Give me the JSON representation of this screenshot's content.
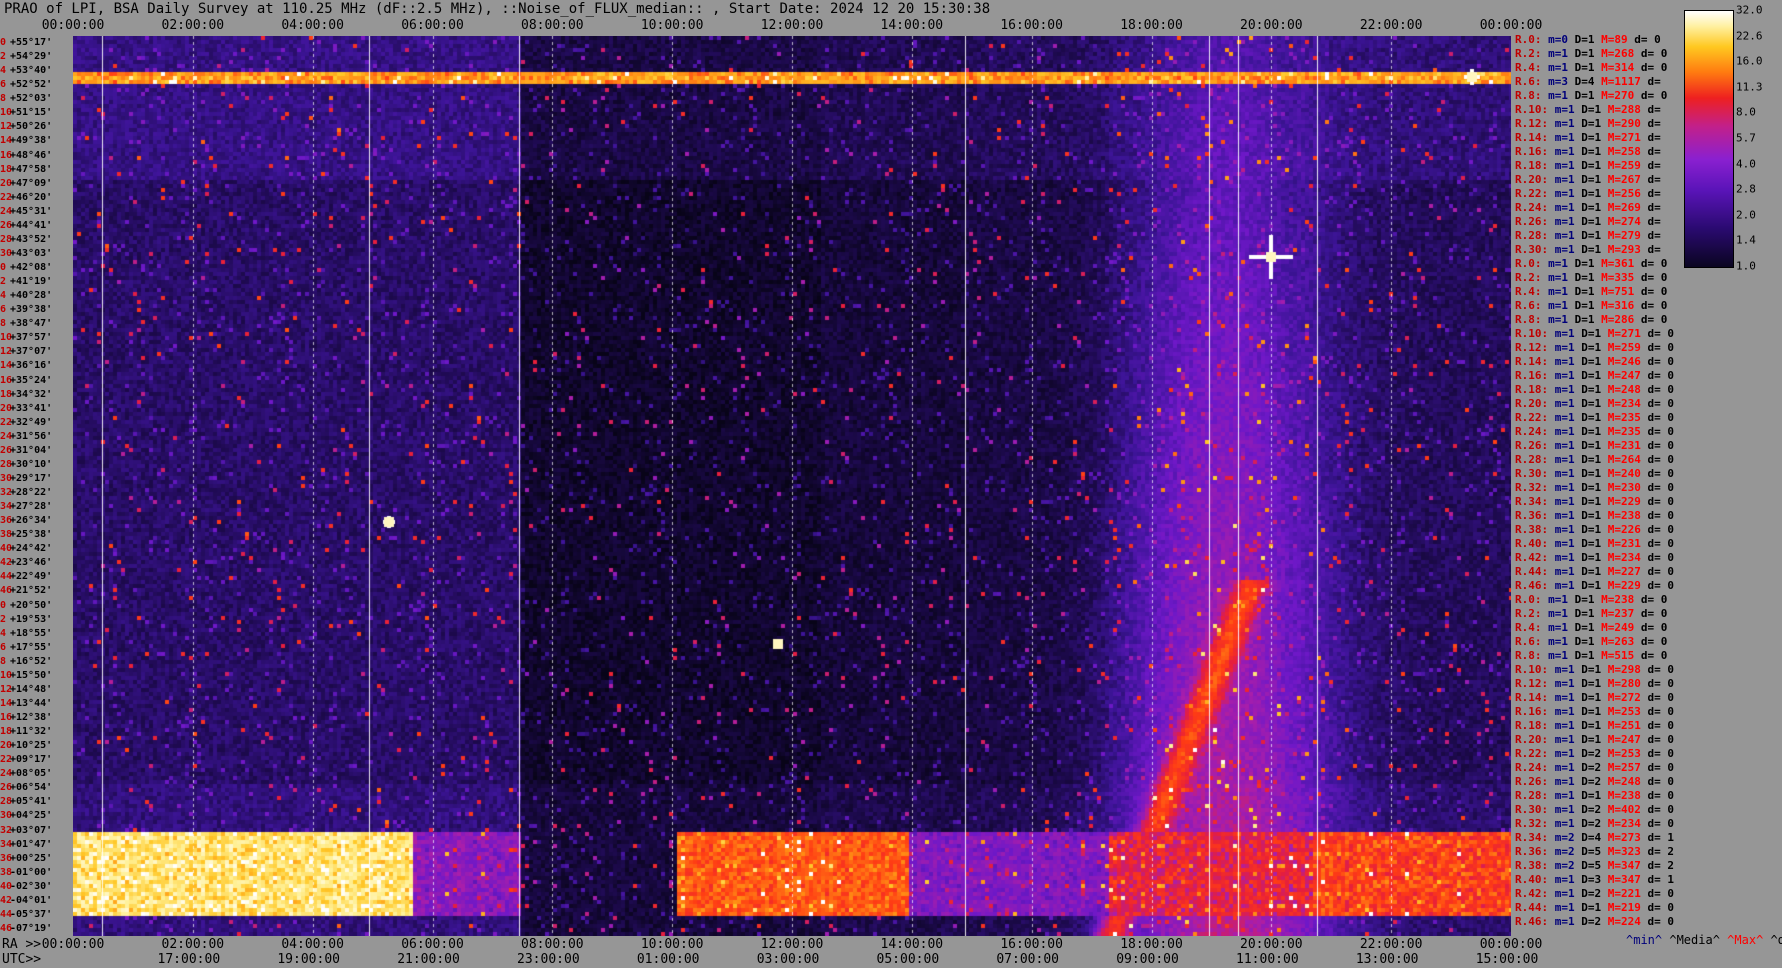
{
  "title": "PRAO of LPI, BSA Daily Survey at 110.25 MHz (dF::2.5 MHz), ::Noise_of_FLUX_median:: , Start Date: 2024 12 20 15:30:38",
  "top_axis_labels": [
    "00:00:00",
    "02:00:00",
    "04:00:00",
    "06:00:00",
    "08:00:00",
    "10:00:00",
    "12:00:00",
    "14:00:00",
    "16:00:00",
    "18:00:00",
    "20:00:00",
    "22:00:00",
    "00:00:00"
  ],
  "ra_prefix": "RA >>",
  "bottom_ra_labels": [
    "00:00:00",
    "02:00:00",
    "04:00:00",
    "06:00:00",
    "08:00:00",
    "10:00:00",
    "12:00:00",
    "14:00:00",
    "16:00:00",
    "18:00:00",
    "20:00:00",
    "22:00:00",
    "00:00:00"
  ],
  "utc_prefix": "UTC>>",
  "utc_labels": [
    "17:00:00",
    "19:00:00",
    "21:00:00",
    "23:00:00",
    "01:00:00",
    "03:00:00",
    "05:00:00",
    "07:00:00",
    "09:00:00",
    "11:00:00",
    "13:00:00",
    "15:00:00"
  ],
  "declination_rows": [
    {
      "idx": "0",
      "dec": "+55°17'"
    },
    {
      "idx": "2",
      "dec": "+54°29'"
    },
    {
      "idx": "4",
      "dec": "+53°40'"
    },
    {
      "idx": "6",
      "dec": "+52°52'"
    },
    {
      "idx": "8",
      "dec": "+52°03'"
    },
    {
      "idx": "10",
      "dec": "+51°15'"
    },
    {
      "idx": "12",
      "dec": "+50°26'"
    },
    {
      "idx": "14",
      "dec": "+49°38'"
    },
    {
      "idx": "16",
      "dec": "+48°46'"
    },
    {
      "idx": "18",
      "dec": "+47°58'"
    },
    {
      "idx": "20",
      "dec": "+47°09'"
    },
    {
      "idx": "22",
      "dec": "+46°20'"
    },
    {
      "idx": "24",
      "dec": "+45°31'"
    },
    {
      "idx": "26",
      "dec": "+44°41'"
    },
    {
      "idx": "28",
      "dec": "+43°52'"
    },
    {
      "idx": "30",
      "dec": "+43°03'"
    },
    {
      "idx": "0",
      "dec": "+42°08'"
    },
    {
      "idx": "2",
      "dec": "+41°19'"
    },
    {
      "idx": "4",
      "dec": "+40°28'"
    },
    {
      "idx": "6",
      "dec": "+39°38'"
    },
    {
      "idx": "8",
      "dec": "+38°47'"
    },
    {
      "idx": "10",
      "dec": "+37°57'"
    },
    {
      "idx": "12",
      "dec": "+37°07'"
    },
    {
      "idx": "14",
      "dec": "+36°16'"
    },
    {
      "idx": "16",
      "dec": "+35°24'"
    },
    {
      "idx": "18",
      "dec": "+34°32'"
    },
    {
      "idx": "20",
      "dec": "+33°41'"
    },
    {
      "idx": "22",
      "dec": "+32°49'"
    },
    {
      "idx": "24",
      "dec": "+31°56'"
    },
    {
      "idx": "26",
      "dec": "+31°04'"
    },
    {
      "idx": "28",
      "dec": "+30°10'"
    },
    {
      "idx": "30",
      "dec": "+29°17'"
    },
    {
      "idx": "32",
      "dec": "+28°22'"
    },
    {
      "idx": "34",
      "dec": "+27°28'"
    },
    {
      "idx": "36",
      "dec": "+26°34'"
    },
    {
      "idx": "38",
      "dec": "+25°38'"
    },
    {
      "idx": "40",
      "dec": "+24°42'"
    },
    {
      "idx": "42",
      "dec": "+23°46'"
    },
    {
      "idx": "44",
      "dec": "+22°49'"
    },
    {
      "idx": "46",
      "dec": "+21°52'"
    },
    {
      "idx": "0",
      "dec": "+20°50'"
    },
    {
      "idx": "2",
      "dec": "+19°53'"
    },
    {
      "idx": "4",
      "dec": "+18°55'"
    },
    {
      "idx": "6",
      "dec": "+17°55'"
    },
    {
      "idx": "8",
      "dec": "+16°52'"
    },
    {
      "idx": "10",
      "dec": "+15°50'"
    },
    {
      "idx": "12",
      "dec": "+14°48'"
    },
    {
      "idx": "14",
      "dec": "+13°44'"
    },
    {
      "idx": "16",
      "dec": "+12°38'"
    },
    {
      "idx": "18",
      "dec": "+11°32'"
    },
    {
      "idx": "20",
      "dec": "+10°25'"
    },
    {
      "idx": "22",
      "dec": "+09°17'"
    },
    {
      "idx": "24",
      "dec": "+08°05'"
    },
    {
      "idx": "26",
      "dec": "+06°54'"
    },
    {
      "idx": "28",
      "dec": "+05°41'"
    },
    {
      "idx": "30",
      "dec": "+04°25'"
    },
    {
      "idx": "32",
      "dec": "+03°07'"
    },
    {
      "idx": "34",
      "dec": "+01°47'"
    },
    {
      "idx": "36",
      "dec": "+00°25'"
    },
    {
      "idx": "38",
      "dec": "-01°00'"
    },
    {
      "idx": "40",
      "dec": "-02°30'"
    },
    {
      "idx": "42",
      "dec": "-04°01'"
    },
    {
      "idx": "44",
      "dec": "-05°37'"
    },
    {
      "idx": "46",
      "dec": "-07°19'"
    }
  ],
  "row_stats": [
    {
      "r": "R.0:",
      "m": "m=0",
      "d": "D=1",
      "max": "M=89",
      "dev": "d= 0"
    },
    {
      "r": "R.2:",
      "m": "m=1",
      "d": "D=1",
      "max": "M=268",
      "dev": "d= 0"
    },
    {
      "r": "R.4:",
      "m": "m=1",
      "d": "D=1",
      "max": "M=314",
      "dev": "d= 0"
    },
    {
      "r": "R.6:",
      "m": "m=3",
      "d": "D=4",
      "max": "M=1117",
      "dev": "d="
    },
    {
      "r": "R.8:",
      "m": "m=1",
      "d": "D=1",
      "max": "M=270",
      "dev": "d= 0"
    },
    {
      "r": "R.10:",
      "m": "m=1",
      "d": "D=1",
      "max": "M=288",
      "dev": "d="
    },
    {
      "r": "R.12:",
      "m": "m=1",
      "d": "D=1",
      "max": "M=290",
      "dev": "d="
    },
    {
      "r": "R.14:",
      "m": "m=1",
      "d": "D=1",
      "max": "M=271",
      "dev": "d="
    },
    {
      "r": "R.16:",
      "m": "m=1",
      "d": "D=1",
      "max": "M=258",
      "dev": "d="
    },
    {
      "r": "R.18:",
      "m": "m=1",
      "d": "D=1",
      "max": "M=259",
      "dev": "d="
    },
    {
      "r": "R.20:",
      "m": "m=1",
      "d": "D=1",
      "max": "M=267",
      "dev": "d="
    },
    {
      "r": "R.22:",
      "m": "m=1",
      "d": "D=1",
      "max": "M=256",
      "dev": "d="
    },
    {
      "r": "R.24:",
      "m": "m=1",
      "d": "D=1",
      "max": "M=269",
      "dev": "d="
    },
    {
      "r": "R.26:",
      "m": "m=1",
      "d": "D=1",
      "max": "M=274",
      "dev": "d="
    },
    {
      "r": "R.28:",
      "m": "m=1",
      "d": "D=1",
      "max": "M=279",
      "dev": "d="
    },
    {
      "r": "R.30:",
      "m": "m=1",
      "d": "D=1",
      "max": "M=293",
      "dev": "d="
    },
    {
      "r": "R.0:",
      "m": "m=1",
      "d": "D=1",
      "max": "M=361",
      "dev": "d= 0"
    },
    {
      "r": "R.2:",
      "m": "m=1",
      "d": "D=1",
      "max": "M=335",
      "dev": "d= 0"
    },
    {
      "r": "R.4:",
      "m": "m=1",
      "d": "D=1",
      "max": "M=751",
      "dev": "d= 0"
    },
    {
      "r": "R.6:",
      "m": "m=1",
      "d": "D=1",
      "max": "M=316",
      "dev": "d= 0"
    },
    {
      "r": "R.8:",
      "m": "m=1",
      "d": "D=1",
      "max": "M=286",
      "dev": "d= 0"
    },
    {
      "r": "R.10:",
      "m": "m=1",
      "d": "D=1",
      "max": "M=271",
      "dev": "d= 0"
    },
    {
      "r": "R.12:",
      "m": "m=1",
      "d": "D=1",
      "max": "M=259",
      "dev": "d= 0"
    },
    {
      "r": "R.14:",
      "m": "m=1",
      "d": "D=1",
      "max": "M=246",
      "dev": "d= 0"
    },
    {
      "r": "R.16:",
      "m": "m=1",
      "d": "D=1",
      "max": "M=247",
      "dev": "d= 0"
    },
    {
      "r": "R.18:",
      "m": "m=1",
      "d": "D=1",
      "max": "M=248",
      "dev": "d= 0"
    },
    {
      "r": "R.20:",
      "m": "m=1",
      "d": "D=1",
      "max": "M=234",
      "dev": "d= 0"
    },
    {
      "r": "R.22:",
      "m": "m=1",
      "d": "D=1",
      "max": "M=235",
      "dev": "d= 0"
    },
    {
      "r": "R.24:",
      "m": "m=1",
      "d": "D=1",
      "max": "M=235",
      "dev": "d= 0"
    },
    {
      "r": "R.26:",
      "m": "m=1",
      "d": "D=1",
      "max": "M=231",
      "dev": "d= 0"
    },
    {
      "r": "R.28:",
      "m": "m=1",
      "d": "D=1",
      "max": "M=264",
      "dev": "d= 0"
    },
    {
      "r": "R.30:",
      "m": "m=1",
      "d": "D=1",
      "max": "M=240",
      "dev": "d= 0"
    },
    {
      "r": "R.32:",
      "m": "m=1",
      "d": "D=1",
      "max": "M=230",
      "dev": "d= 0"
    },
    {
      "r": "R.34:",
      "m": "m=1",
      "d": "D=1",
      "max": "M=229",
      "dev": "d= 0"
    },
    {
      "r": "R.36:",
      "m": "m=1",
      "d": "D=1",
      "max": "M=238",
      "dev": "d= 0"
    },
    {
      "r": "R.38:",
      "m": "m=1",
      "d": "D=1",
      "max": "M=226",
      "dev": "d= 0"
    },
    {
      "r": "R.40:",
      "m": "m=1",
      "d": "D=1",
      "max": "M=231",
      "dev": "d= 0"
    },
    {
      "r": "R.42:",
      "m": "m=1",
      "d": "D=1",
      "max": "M=234",
      "dev": "d= 0"
    },
    {
      "r": "R.44:",
      "m": "m=1",
      "d": "D=1",
      "max": "M=227",
      "dev": "d= 0"
    },
    {
      "r": "R.46:",
      "m": "m=1",
      "d": "D=1",
      "max": "M=229",
      "dev": "d= 0"
    },
    {
      "r": "R.0:",
      "m": "m=1",
      "d": "D=1",
      "max": "M=238",
      "dev": "d= 0"
    },
    {
      "r": "R.2:",
      "m": "m=1",
      "d": "D=1",
      "max": "M=237",
      "dev": "d= 0"
    },
    {
      "r": "R.4:",
      "m": "m=1",
      "d": "D=1",
      "max": "M=249",
      "dev": "d= 0"
    },
    {
      "r": "R.6:",
      "m": "m=1",
      "d": "D=1",
      "max": "M=263",
      "dev": "d= 0"
    },
    {
      "r": "R.8:",
      "m": "m=1",
      "d": "D=1",
      "max": "M=515",
      "dev": "d= 0"
    },
    {
      "r": "R.10:",
      "m": "m=1",
      "d": "D=1",
      "max": "M=298",
      "dev": "d= 0"
    },
    {
      "r": "R.12:",
      "m": "m=1",
      "d": "D=1",
      "max": "M=280",
      "dev": "d= 0"
    },
    {
      "r": "R.14:",
      "m": "m=1",
      "d": "D=1",
      "max": "M=272",
      "dev": "d= 0"
    },
    {
      "r": "R.16:",
      "m": "m=1",
      "d": "D=1",
      "max": "M=253",
      "dev": "d= 0"
    },
    {
      "r": "R.18:",
      "m": "m=1",
      "d": "D=1",
      "max": "M=251",
      "dev": "d= 0"
    },
    {
      "r": "R.20:",
      "m": "m=1",
      "d": "D=1",
      "max": "M=247",
      "dev": "d= 0"
    },
    {
      "r": "R.22:",
      "m": "m=1",
      "d": "D=2",
      "max": "M=253",
      "dev": "d= 0"
    },
    {
      "r": "R.24:",
      "m": "m=1",
      "d": "D=2",
      "max": "M=257",
      "dev": "d= 0"
    },
    {
      "r": "R.26:",
      "m": "m=1",
      "d": "D=2",
      "max": "M=248",
      "dev": "d= 0"
    },
    {
      "r": "R.28:",
      "m": "m=1",
      "d": "D=1",
      "max": "M=238",
      "dev": "d= 0"
    },
    {
      "r": "R.30:",
      "m": "m=1",
      "d": "D=2",
      "max": "M=402",
      "dev": "d= 0"
    },
    {
      "r": "R.32:",
      "m": "m=1",
      "d": "D=2",
      "max": "M=234",
      "dev": "d= 0"
    },
    {
      "r": "R.34:",
      "m": "m=2",
      "d": "D=4",
      "max": "M=273",
      "dev": "d= 1"
    },
    {
      "r": "R.36:",
      "m": "m=2",
      "d": "D=5",
      "max": "M=323",
      "dev": "d= 2"
    },
    {
      "r": "R.38:",
      "m": "m=2",
      "d": "D=5",
      "max": "M=347",
      "dev": "d= 2"
    },
    {
      "r": "R.40:",
      "m": "m=1",
      "d": "D=3",
      "max": "M=347",
      "dev": "d= 1"
    },
    {
      "r": "R.42:",
      "m": "m=1",
      "d": "D=2",
      "max": "M=221",
      "dev": "d= 0"
    },
    {
      "r": "R.44:",
      "m": "m=1",
      "d": "D=1",
      "max": "M=219",
      "dev": "d= 0"
    },
    {
      "r": "R.46:",
      "m": "m=1",
      "d": "D=2",
      "max": "M=224",
      "dev": "d= 0"
    }
  ],
  "colorbar_ticks": [
    "32.0",
    "22.6",
    "16.0",
    "11.3",
    "8.0",
    "5.7",
    "4.0",
    "2.8",
    "2.0",
    "1.4",
    "1.0"
  ],
  "legend": {
    "min": "^min^",
    "median": "^Media^",
    "max": "^Max^",
    "devia": "^devia^"
  },
  "colors": {
    "background": "#969696",
    "plot_dark": "#0a0520",
    "low": "#2a0a70",
    "mid": "#7a1ad0",
    "hot": "#ff3010",
    "peak": "#fff6c0"
  },
  "chart_data": {
    "type": "heatmap",
    "title": "PRAO of LPI, BSA Daily Survey at 110.25 MHz (dF::2.5 MHz), ::Noise_of_FLUX_median:: , Start Date: 2024 12 20 15:30:38",
    "x_axis": "RA",
    "x_range": [
      "00:00:00",
      "24:00:00"
    ],
    "y_range_dec": [
      "+55°17'",
      "-07°19'"
    ],
    "colorbar_range": [
      1.0,
      32.0
    ],
    "colorbar_scale": "log",
    "features": [
      {
        "desc": "bright horizontal band",
        "dec": "+52°52'",
        "ra_range": [
          "00:00",
          "24:00"
        ],
        "level": 16
      },
      {
        "desc": "bright band",
        "dec_range": [
          "+01°47'",
          "-01°00'"
        ],
        "ra_range": [
          "00:00",
          "06:30"
        ],
        "level": 22
      },
      {
        "desc": "bright band",
        "dec_range": [
          "+01°47'",
          "-01°00'"
        ],
        "ra_range": [
          "12:00",
          "15:50"
        ],
        "level": 9
      },
      {
        "desc": "bright band",
        "dec_range": [
          "+01°47'",
          "-01°00'"
        ],
        "ra_range": [
          "21:00",
          "24:00"
        ],
        "level": 9
      },
      {
        "desc": "milky way diffuse emission",
        "ra_range": [
          "17:40",
          "21:00"
        ],
        "level": 4
      },
      {
        "desc": "point source",
        "ra": "20:00",
        "dec": "+41°19'",
        "level": 32
      },
      {
        "desc": "point source",
        "ra": "23:20",
        "dec": "+52°52'",
        "level": 32
      }
    ]
  }
}
